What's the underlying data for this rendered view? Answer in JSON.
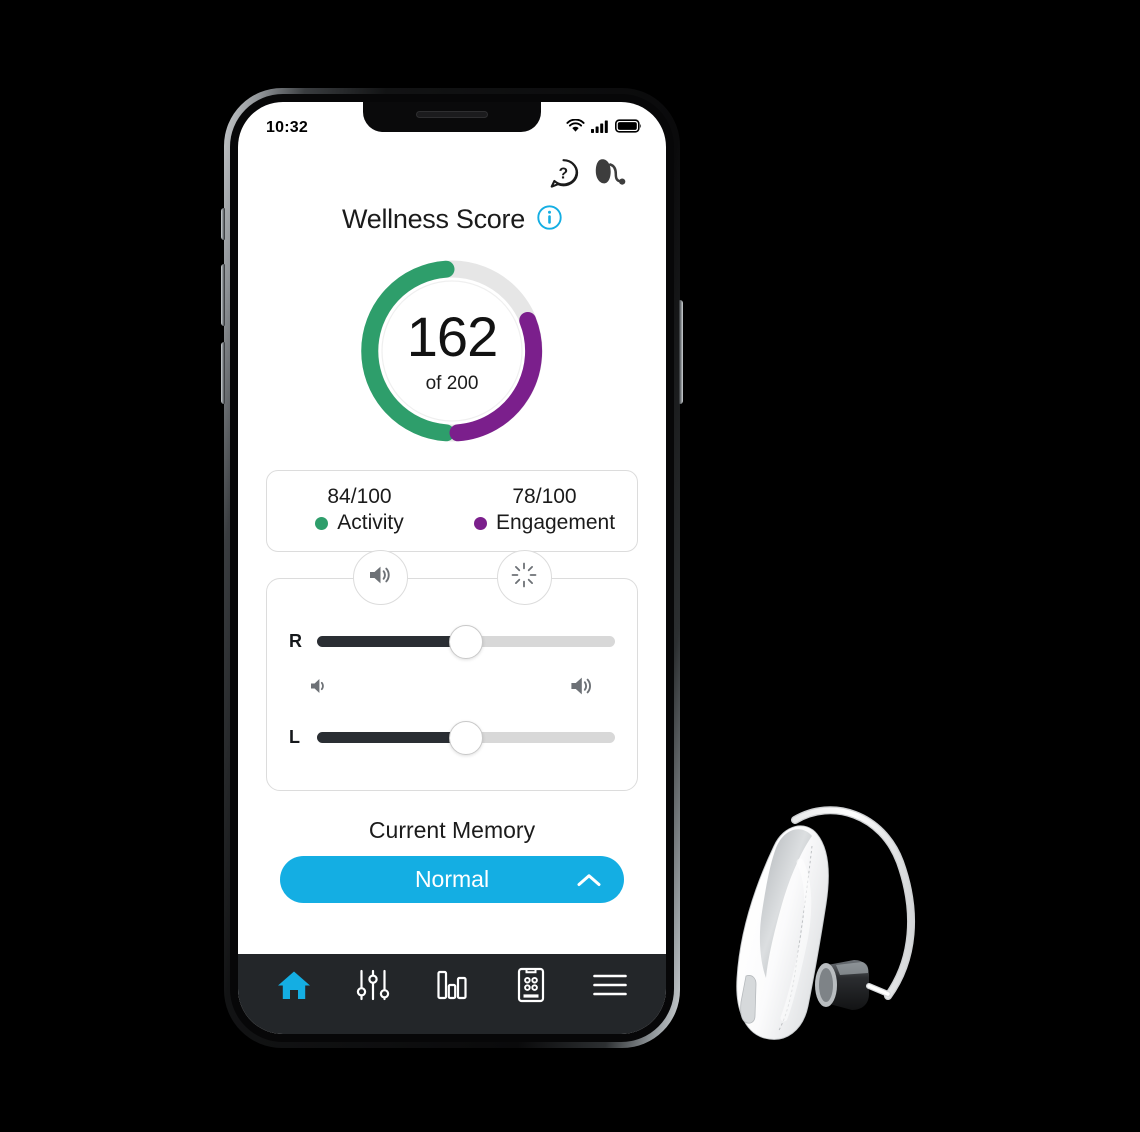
{
  "colors": {
    "accent_blue": "#14aee3",
    "activity_green": "#2e9e6b",
    "engagement_purple": "#7b1f8c",
    "ring_track": "#e6e6e6",
    "slider_fill": "#2a2e33",
    "slider_track": "#d8d8d8",
    "nav_bar": "#232629",
    "background": "#000000"
  },
  "status_bar": {
    "time": "10:32",
    "wifi_icon": "wifi-icon",
    "cellular_icon": "cellular-signal-icon",
    "battery_icon": "battery-full-icon"
  },
  "app_header": {
    "help_icon": "help-question-bubble-icon",
    "hearing_aid_icon": "hearing-aid-icon"
  },
  "title": {
    "text": "Wellness Score",
    "info_icon": "info-icon"
  },
  "wellness": {
    "score": "162",
    "total_label": "of 200",
    "score_value": 162,
    "score_max": 200,
    "breakdown": [
      {
        "value": "84/100",
        "label": "Activity",
        "color": "#2e9e6b",
        "number": 84,
        "max": 100
      },
      {
        "value": "78/100",
        "label": "Engagement",
        "color": "#7b1f8c",
        "number": 78,
        "max": 100
      }
    ]
  },
  "controls": {
    "tabs": [
      {
        "name": "volume-tab",
        "icon": "speaker-volume-icon",
        "active": true
      },
      {
        "name": "noise-reduction-tab",
        "icon": "noise-burst-icon",
        "active": false
      }
    ],
    "sliders": [
      {
        "label": "R",
        "name": "right-volume-slider",
        "percent": 50
      },
      {
        "label": "L",
        "name": "left-volume-slider",
        "percent": 50
      }
    ],
    "volume_down_icon": "volume-low-icon",
    "volume_up_icon": "volume-high-icon"
  },
  "memory": {
    "label": "Current Memory",
    "selected": "Normal",
    "chevron_icon": "chevron-up-icon"
  },
  "bottom_nav": [
    {
      "name": "nav-home",
      "icon": "home-icon",
      "active": true
    },
    {
      "name": "nav-adjust",
      "icon": "sliders-equalizer-icon",
      "active": false
    },
    {
      "name": "nav-stats",
      "icon": "bar-chart-icon",
      "active": false
    },
    {
      "name": "nav-remote",
      "icon": "remote-control-icon",
      "active": false
    },
    {
      "name": "nav-menu",
      "icon": "hamburger-menu-icon",
      "active": false
    }
  ],
  "product": {
    "name": "hearing-aid-product-image",
    "description": "receiver-in-canal hearing aid"
  }
}
